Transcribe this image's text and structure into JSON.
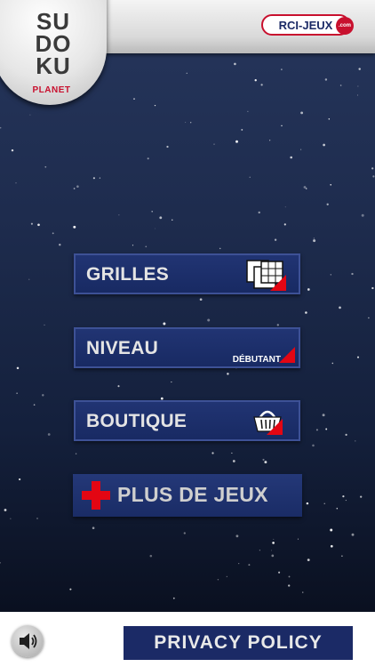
{
  "header": {
    "logo_lines": [
      "SU",
      "DO",
      "KU"
    ],
    "logo_subtitle": "PLANET",
    "brand": "RCI-JEUX",
    "brand_badge": ".com",
    "brand_color": "#c8102e"
  },
  "menu": {
    "grids_label": "GRILLES",
    "level_label": "NIVEAU",
    "level_value": "DÉBUTANT",
    "shop_label": "BOUTIQUE",
    "more_games_label": "PLUS DE JEUX",
    "button_color": "#1b2a66",
    "accent_color": "#e30613"
  },
  "footer": {
    "sound_icon": "speaker-icon",
    "privacy_label": "PRIVACY POLICY"
  }
}
